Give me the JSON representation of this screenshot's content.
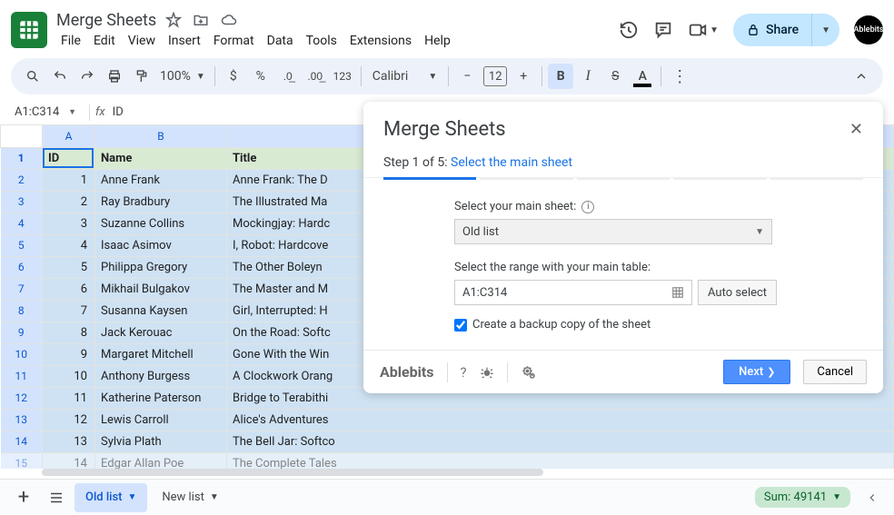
{
  "doc": {
    "title": "Merge Sheets"
  },
  "menu": [
    "File",
    "Edit",
    "View",
    "Insert",
    "Format",
    "Data",
    "Tools",
    "Extensions",
    "Help"
  ],
  "share": {
    "label": "Share"
  },
  "avatar": "Ablebits",
  "toolbar": {
    "zoom": "100%",
    "font": "Calibri",
    "font_size": "12"
  },
  "namebox": {
    "ref": "A1:C314",
    "fx_value": "ID"
  },
  "cols": [
    "A",
    "B"
  ],
  "headers": {
    "id": "ID",
    "name": "Name",
    "title": "Title"
  },
  "rows": [
    {
      "n": 1,
      "id": "1",
      "name": "Anne Frank",
      "title": "Anne Frank: The D"
    },
    {
      "n": 2,
      "id": "2",
      "name": "Ray Bradbury",
      "title": "The Illustrated Ma"
    },
    {
      "n": 3,
      "id": "3",
      "name": "Suzanne Collins",
      "title": "Mockingjay: Hardc"
    },
    {
      "n": 4,
      "id": "4",
      "name": "Isaac Asimov",
      "title": "I, Robot: Hardcove"
    },
    {
      "n": 5,
      "id": "5",
      "name": "Philippa Gregory",
      "title": "The Other Boleyn "
    },
    {
      "n": 6,
      "id": "6",
      "name": "Mikhail Bulgakov",
      "title": "The Master and M"
    },
    {
      "n": 7,
      "id": "7",
      "name": "Susanna Kaysen",
      "title": "Girl, Interrupted: H"
    },
    {
      "n": 8,
      "id": "8",
      "name": "Jack Kerouac",
      "title": "On the Road: Softc"
    },
    {
      "n": 9,
      "id": "9",
      "name": "Margaret Mitchell",
      "title": "Gone With the Win"
    },
    {
      "n": 10,
      "id": "10",
      "name": "Anthony Burgess",
      "title": "A Clockwork Orang"
    },
    {
      "n": 11,
      "id": "11",
      "name": "Katherine Paterson",
      "title": "Bridge to Terabithi"
    },
    {
      "n": 12,
      "id": "12",
      "name": "Lewis Carroll",
      "title": "Alice's Adventures"
    },
    {
      "n": 13,
      "id": "13",
      "name": "Sylvia Plath",
      "title": "The Bell Jar: Softco"
    },
    {
      "n": 14,
      "id": "14",
      "name": "Edgar Allan Poe",
      "title": "The Complete Tales"
    }
  ],
  "tabs": [
    {
      "label": "Old list",
      "active": true
    },
    {
      "label": "New list",
      "active": false
    }
  ],
  "sum": "Sum: 49141",
  "addon": {
    "title": "Merge Sheets",
    "step_prefix": "Step 1 of 5: ",
    "step_name": "Select the main sheet",
    "label_main": "Select your main sheet:",
    "selected_sheet": "Old list",
    "label_range": "Select the range with your main table:",
    "range": "A1:C314",
    "auto_select": "Auto select",
    "backup_label": "Create a backup copy of the sheet",
    "brand": "Ablebits",
    "next": "Next",
    "cancel": "Cancel"
  }
}
